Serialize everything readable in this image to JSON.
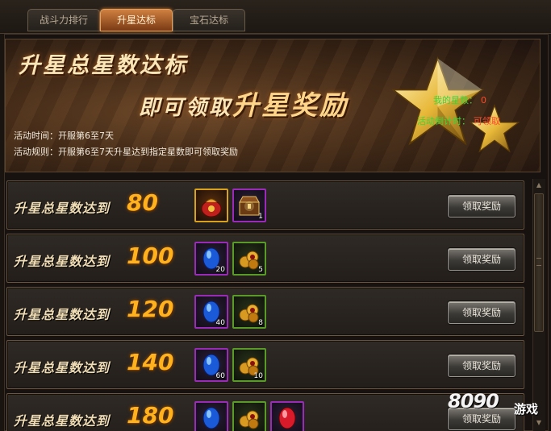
{
  "tabs": [
    {
      "label": "战斗力排行",
      "active": false
    },
    {
      "label": "升星达标",
      "active": true
    },
    {
      "label": "宝石达标",
      "active": false
    }
  ],
  "banner": {
    "title": "升星总星数达标",
    "subtitle_prefix": "即可领取",
    "subtitle_highlight": "升星奖励",
    "time_label": "活动时间：",
    "time_value": "开服第6至7天",
    "rule_label": "活动规则：",
    "rule_value": "开服第6至7天升星达到指定星数即可领取奖励",
    "my_stars_label": "我的星数：",
    "my_stars_value": "0",
    "countdown_label": "活动倒计时：",
    "countdown_value": "可领取"
  },
  "rewards": {
    "row_label": "升星总星数达到",
    "claim_label": "领取奖励",
    "rows": [
      {
        "target": "80",
        "items": [
          {
            "icon": "red-pouch-icon",
            "frame": "gold",
            "qty": ""
          },
          {
            "icon": "treasure-chest-icon",
            "frame": "purple",
            "qty": "1"
          }
        ]
      },
      {
        "target": "100",
        "items": [
          {
            "icon": "blue-gem-icon",
            "frame": "purple",
            "qty": "20"
          },
          {
            "icon": "gold-coin-pile-icon",
            "frame": "green",
            "qty": "5"
          }
        ]
      },
      {
        "target": "120",
        "items": [
          {
            "icon": "blue-gem-icon",
            "frame": "purple",
            "qty": "40"
          },
          {
            "icon": "gold-coin-pile-icon",
            "frame": "green",
            "qty": "8"
          }
        ]
      },
      {
        "target": "140",
        "items": [
          {
            "icon": "blue-gem-icon",
            "frame": "purple",
            "qty": "60"
          },
          {
            "icon": "gold-coin-pile-icon",
            "frame": "green",
            "qty": "10"
          }
        ]
      },
      {
        "target": "180",
        "items": [
          {
            "icon": "blue-gem-icon",
            "frame": "purple",
            "qty": ""
          },
          {
            "icon": "gold-coin-pile-icon",
            "frame": "green",
            "qty": ""
          },
          {
            "icon": "red-gem-icon",
            "frame": "purple",
            "qty": ""
          }
        ]
      }
    ]
  },
  "watermark": {
    "digits": "8090",
    "text": "游戏"
  },
  "colors": {
    "accent_orange": "#ffb21e",
    "green_text": "#38d838",
    "red_text": "#ff4a2a"
  }
}
